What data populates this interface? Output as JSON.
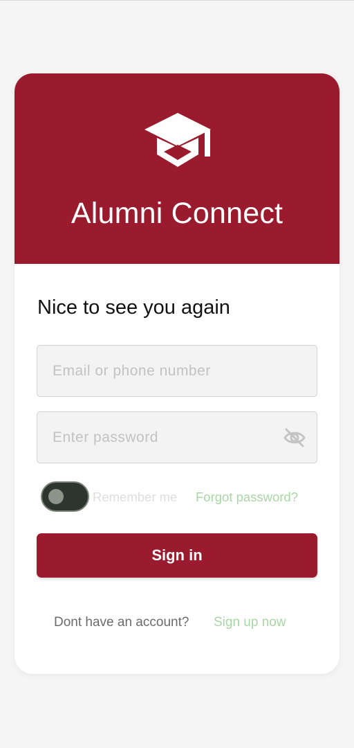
{
  "app": {
    "title": "Alumni Connect",
    "logo_icon": "graduation-cap-icon"
  },
  "login": {
    "greeting": "Nice to see you again",
    "email_placeholder": "Email or phone number",
    "email_value": "",
    "password_placeholder": "Enter password",
    "password_value": "",
    "password_visibility_icon": "eye-off-icon",
    "remember_label": "Remember me",
    "remember_enabled": false,
    "forgot_label": "Forgot password?",
    "signin_label": "Sign in",
    "signup_prompt": "Dont have an account?",
    "signup_link": "Sign up now"
  },
  "colors": {
    "brand": "#9b1b2e",
    "link": "#a8d6a4",
    "background": "#f5f5f5"
  }
}
